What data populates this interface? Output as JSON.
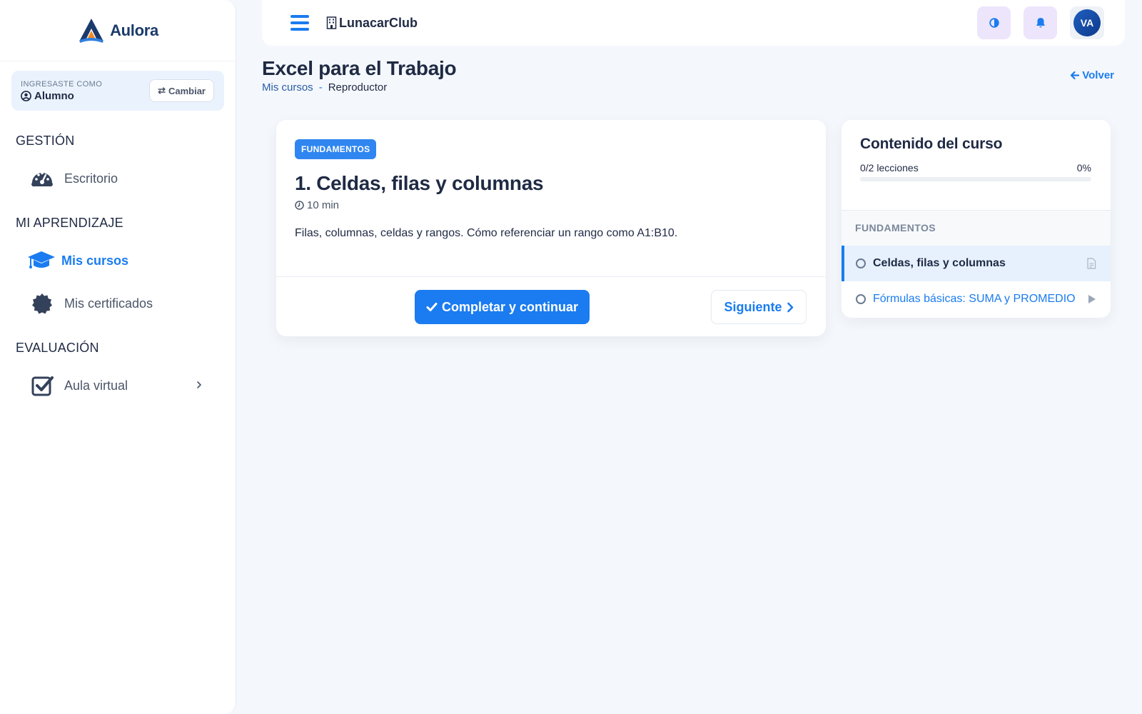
{
  "sidebar": {
    "brand": "Aulora",
    "role": {
      "caption": "INGRESASTE COMO",
      "name": "Alumno",
      "switch_label": "Cambiar"
    },
    "sections": [
      {
        "title": "GESTIÓN",
        "items": [
          {
            "label": "Escritorio",
            "icon": "dashboard-icon"
          }
        ]
      },
      {
        "title": "MI APRENDIZAJE",
        "items": [
          {
            "label": "Mis cursos",
            "icon": "graduation-cap-icon",
            "active": true
          },
          {
            "label": "Mis certificados",
            "icon": "certificate-icon"
          }
        ]
      },
      {
        "title": "EVALUACIÓN",
        "items": [
          {
            "label": "Aula virtual",
            "icon": "check-square-icon",
            "has_submenu": true
          }
        ]
      }
    ]
  },
  "header": {
    "org_name": "LunacarClub",
    "avatar_initials": "VA",
    "theme_icon": "contrast-icon",
    "notifications_icon": "bell-icon"
  },
  "page": {
    "title": "Excel para el Trabajo",
    "breadcrumb": {
      "parent": "Mis cursos",
      "separator": "-",
      "current": "Reproductor"
    },
    "back_label": "Volver"
  },
  "lesson": {
    "module_badge": "FUNDAMENTOS",
    "title": "1. Celdas, filas y columnas",
    "duration": "10 min",
    "description": "Filas, columnas, celdas y rangos. Cómo referenciar un rango como A1:B10.",
    "complete_label": "Completar y continuar",
    "next_label": "Siguiente"
  },
  "course_content": {
    "title": "Contenido del curso",
    "progress_text": "0/2 lecciones",
    "progress_percent": "0%",
    "progress_value": 0,
    "modules": [
      {
        "title": "FUNDAMENTOS",
        "lessons": [
          {
            "label": "Celdas, filas y columnas",
            "type": "document-icon",
            "current": true
          },
          {
            "label": "Fórmulas básicas: SUMA y PROMEDIO",
            "type": "play-icon",
            "current": false
          }
        ]
      }
    ]
  },
  "colors": {
    "accent": "#1a7cf0",
    "brand_navy": "#1b3a6b",
    "brand_orange": "#f08a24",
    "icon_button_bg": "#ece5fb"
  }
}
